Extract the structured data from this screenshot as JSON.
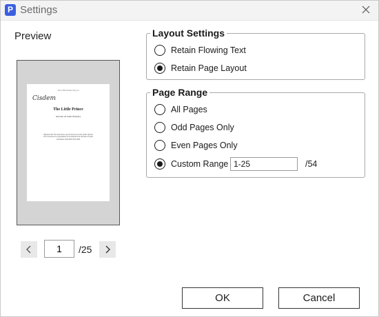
{
  "window": {
    "title": "Settings",
    "app_icon_letter": "P",
    "accent_color": "#3b5fe0"
  },
  "preview": {
    "label": "Preview",
    "page": {
      "header_line": "Some PDF Reader Story.txt",
      "logo_text": "Cisdem",
      "title": "The Little Prince",
      "author": "Antoine de Saint-Exupéry",
      "body_lines": [
        "Shipped with The Little Prince and Inventory are both public domain",
        "This conversion is Copyrighted by the Ebooks and Literature Project",
        "Translated 11/06 PDF  PDF 2023"
      ]
    },
    "pager": {
      "prev_icon": "chevron-left-icon",
      "next_icon": "chevron-right-icon",
      "current_page": "1",
      "total_pages": "/25"
    }
  },
  "layout_settings": {
    "legend": "Layout Settings",
    "options": [
      {
        "label": "Retain Flowing Text",
        "checked": false
      },
      {
        "label": "Retain Page Layout",
        "checked": true
      }
    ]
  },
  "page_range": {
    "legend": "Page Range",
    "options": [
      {
        "label": "All Pages",
        "checked": false
      },
      {
        "label": "Odd Pages Only",
        "checked": false
      },
      {
        "label": "Even Pages Only",
        "checked": false
      },
      {
        "label": "Custom Range",
        "checked": true
      }
    ],
    "custom_value": "1-25",
    "total": "/54"
  },
  "buttons": {
    "ok": "OK",
    "cancel": "Cancel"
  }
}
